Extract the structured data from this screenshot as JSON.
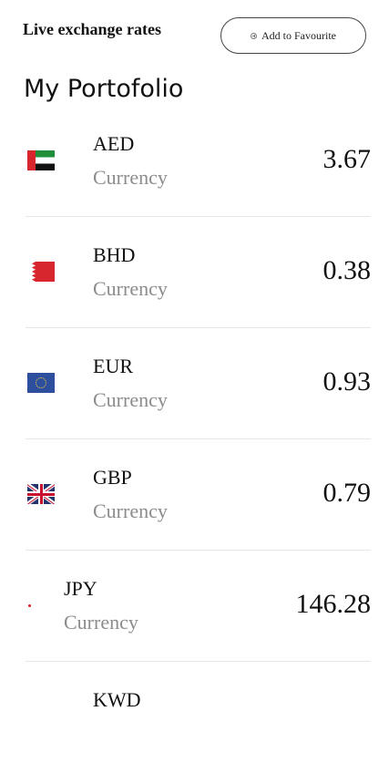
{
  "header": {
    "title": "Live exchange rates",
    "favourite_label": "Add to Favourite"
  },
  "page": {
    "title": "My Portofolio"
  },
  "currencies": [
    {
      "code": "AED",
      "label": "Currency",
      "rate": "3.67",
      "flag": "uae-flag-icon"
    },
    {
      "code": "BHD",
      "label": "Currency",
      "rate": "0.38",
      "flag": "bahrain-flag-icon"
    },
    {
      "code": "EUR",
      "label": "Currency",
      "rate": "0.93",
      "flag": "eu-flag-icon"
    },
    {
      "code": "GBP",
      "label": "Currency",
      "rate": "0.79",
      "flag": "uk-flag-icon"
    },
    {
      "code": "JPY",
      "label": "Currency",
      "rate": "146.28",
      "flag": "japan-flag-icon"
    },
    {
      "code": "KWD",
      "label": "",
      "rate": "",
      "flag": ""
    }
  ]
}
